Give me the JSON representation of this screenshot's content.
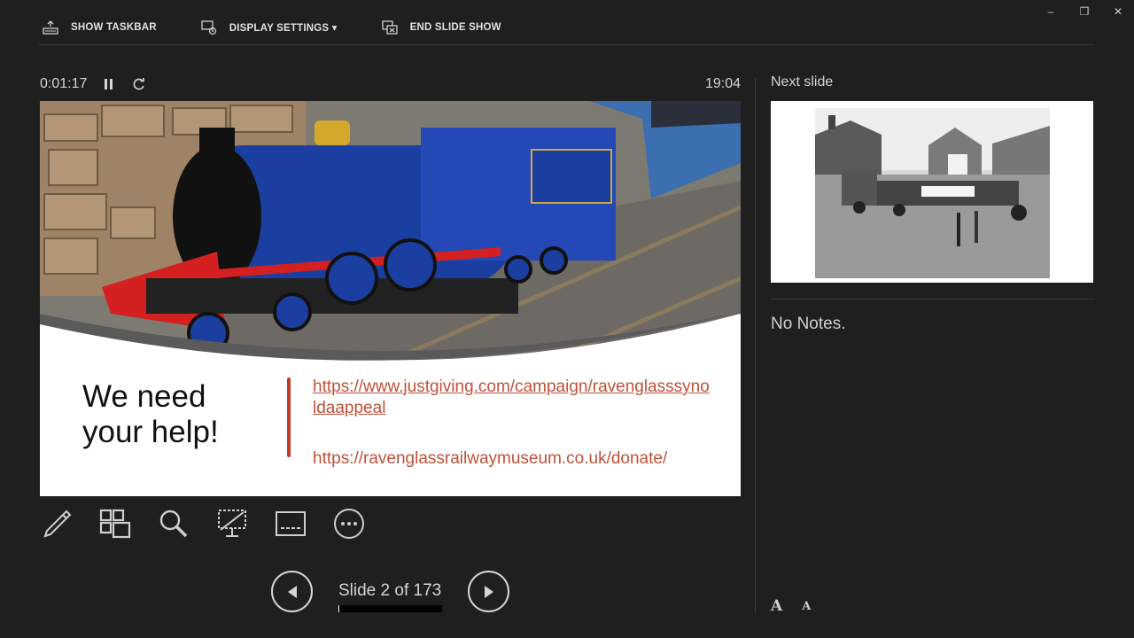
{
  "window_controls": {
    "minimize": "–",
    "restore": "❐",
    "close": "✕"
  },
  "toolbar": {
    "show_taskbar": "SHOW TASKBAR",
    "display_settings": "DISPLAY SETTINGS ▾",
    "end_slide_show": "END SLIDE SHOW"
  },
  "presenter": {
    "elapsed": "0:01:17",
    "clock": "19:04"
  },
  "current_slide": {
    "headline_line1": "We need",
    "headline_line2": "your help!",
    "link1": "https://www.justgiving.com/campaign/ravenglasssynoldaappeal",
    "link2": "https://ravenglassrailwaymuseum.co.uk/donate/",
    "photo_icon": "steam-locomotive-photo",
    "accent_color": "#c0392b"
  },
  "tools": [
    {
      "icon": "pen-icon"
    },
    {
      "icon": "see-all-slides-icon"
    },
    {
      "icon": "zoom-icon"
    },
    {
      "icon": "black-screen-icon"
    },
    {
      "icon": "subtitles-icon"
    },
    {
      "icon": "more-options-icon"
    }
  ],
  "navigation": {
    "slide_count": "Slide 2 of 173",
    "progress_fraction": 0.0116
  },
  "next_panel": {
    "label": "Next slide",
    "thumb_icon": "station-photo"
  },
  "notes": {
    "text": "No Notes."
  },
  "font_buttons": {
    "increase": "A",
    "decrease": "A"
  }
}
